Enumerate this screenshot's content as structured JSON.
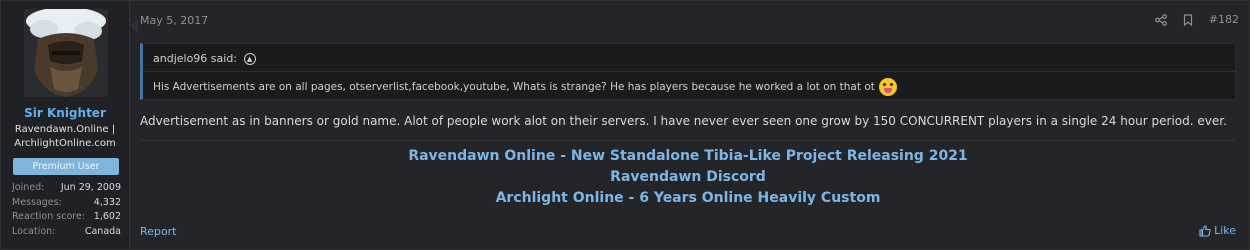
{
  "user": {
    "name": "Sir Knighter",
    "title_line1": "Ravendawn.Online |",
    "title_line2": "ArchlightOnline.com",
    "badge": "Premium User",
    "stats": [
      {
        "label": "Joined:",
        "value": "Jun 29, 2009"
      },
      {
        "label": "Messages:",
        "value": "4,332"
      },
      {
        "label": "Reaction score:",
        "value": "1,602"
      },
      {
        "label": "Location:",
        "value": "Canada"
      }
    ]
  },
  "post": {
    "date": "May 5, 2017",
    "number": "#182",
    "quote": {
      "author": "andjelo96 said:",
      "text": "His Advertisements are on all pages, otserverlist,facebook,youtube, Whats is strange? He has players because he worked a lot on that ot"
    },
    "message": "Advertisement as in banners or gold name. Alot of people work alot on their servers. I have never ever seen one grow by 150 CONCURRENT players in a single 24 hour period. ever.",
    "signature": [
      "Ravendawn Online - New Standalone Tibia-Like Project Releasing 2021",
      "Ravendawn Discord",
      "Archlight Online - 6 Years Online Heavily Custom"
    ],
    "report_label": "Report",
    "like_label": "Like"
  },
  "icons": {
    "share": "share-icon",
    "bookmark": "bookmark-icon",
    "quote_up": "arrow-up-circle-icon",
    "like": "thumbs-up-icon",
    "emoji": "tongue-out-emoji-icon"
  },
  "colors": {
    "accent": "#7cb6e6",
    "username": "#5fb2ea",
    "badge": "#7fb5dc",
    "quote_border": "#3f78a6"
  }
}
